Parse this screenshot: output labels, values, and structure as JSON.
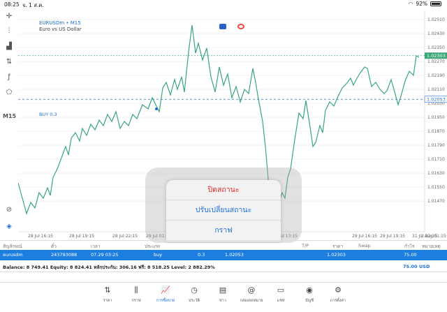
{
  "status_bar": {
    "time": "08:25",
    "date": "จ. 1 ส.ค.",
    "battery": "92%"
  },
  "toolbar": {
    "timeframe": "M15"
  },
  "chart": {
    "symbol": "EURUSDm • M15",
    "description": "Euro vs US Dollar",
    "buy_label": "BUY 0.3",
    "current_price": "1.02303",
    "buy_price": "1.02053",
    "price_ticks": [
      "1.02510",
      "1.02430",
      "1.02350",
      "1.02270",
      "1.02190",
      "1.02110",
      "1.02030",
      "1.01950",
      "1.01870",
      "1.01790",
      "1.01710",
      "1.01630",
      "1.01550",
      "1.01470"
    ],
    "time_ticks": [
      "28 Jul 16:15",
      "28 Jul 19:15",
      "28 Jul 22:15",
      "29 Jul 01:15",
      "29 Jul 13:15",
      "29 Jul 16:15",
      "29 Jul 19:15",
      "31 Jul 22:15",
      "1 Aug 01:15"
    ],
    "colors": {
      "line": "#3aa67a",
      "buy": "#1e6fd9",
      "grid": "#e6e6e6"
    }
  },
  "context_menu": {
    "items": [
      {
        "label": "ปิดสถานะ",
        "color": "red"
      },
      {
        "label": "ปรับเปลี่ยนสถานะ",
        "color": "blue"
      },
      {
        "label": "กราฟ",
        "color": "blue"
      }
    ]
  },
  "table": {
    "headers": [
      "สัญลักษณ์",
      "ตั๋ว",
      "เวลา",
      "ประเภท",
      "T/P",
      "ราคา",
      "Swap",
      "กำไร",
      "หมายเหตุ"
    ],
    "row": {
      "symbol": "eurusdm",
      "ticket": "243793088",
      "time": "07.29 03:25",
      "type": "buy",
      "volume": "0.3",
      "open_price": "1.02053",
      "price": "1.02303",
      "profit": "75.00"
    }
  },
  "balance": {
    "text": "Balance: 8 749.41 Equity: 8 824.41 หลักประกัน: 306.16 ฟรี: 8 518.25 Level: 2 882.29%",
    "profit": "75.00",
    "currency": "USD"
  },
  "bottom_nav": [
    {
      "label": "ราคา",
      "icon": "arrows-updown-icon"
    },
    {
      "label": "กราฟ",
      "icon": "candlestick-icon"
    },
    {
      "label": "การซื้อขาย",
      "icon": "trade-chart-icon",
      "active": true
    },
    {
      "label": "ประวัติ",
      "icon": "history-icon"
    },
    {
      "label": "ข่าว",
      "icon": "news-icon"
    },
    {
      "label": "กล่องจดหมาย",
      "icon": "mail-at-icon"
    },
    {
      "label": "แชท",
      "icon": "chat-icon"
    },
    {
      "label": "บัญชี",
      "icon": "account-icon"
    },
    {
      "label": "การตั้งค่า",
      "icon": "gear-icon"
    }
  ]
}
